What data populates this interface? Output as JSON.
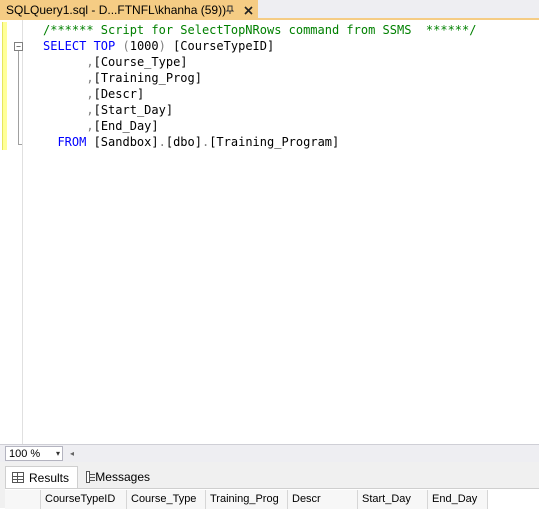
{
  "tab": {
    "title": "SQLQuery1.sql - D...FTNFL\\khanha (59))",
    "pin_icon": "pin-icon",
    "close_icon": "close-icon"
  },
  "editor": {
    "lines": [
      [
        {
          "t": "/****** Script for SelectTopNRows command from SSMS  ******/",
          "c": "cm"
        }
      ],
      [
        {
          "t": "SELECT ",
          "c": "kw"
        },
        {
          "t": "TOP ",
          "c": "kw"
        },
        {
          "t": "(",
          "c": "gr"
        },
        {
          "t": "1000",
          "c": ""
        },
        {
          "t": ") ",
          "c": "gr"
        },
        {
          "t": "[CourseTypeID]",
          "c": ""
        }
      ],
      [
        {
          "t": "      ",
          "c": ""
        },
        {
          "t": ",",
          "c": "gr"
        },
        {
          "t": "[Course_Type]",
          "c": ""
        }
      ],
      [
        {
          "t": "      ",
          "c": ""
        },
        {
          "t": ",",
          "c": "gr"
        },
        {
          "t": "[Training_Prog]",
          "c": ""
        }
      ],
      [
        {
          "t": "      ",
          "c": ""
        },
        {
          "t": ",",
          "c": "gr"
        },
        {
          "t": "[Descr]",
          "c": ""
        }
      ],
      [
        {
          "t": "      ",
          "c": ""
        },
        {
          "t": ",",
          "c": "gr"
        },
        {
          "t": "[Start_Day]",
          "c": ""
        }
      ],
      [
        {
          "t": "      ",
          "c": ""
        },
        {
          "t": ",",
          "c": "gr"
        },
        {
          "t": "[End_Day]",
          "c": ""
        }
      ],
      [
        {
          "t": "  FROM ",
          "c": "kw"
        },
        {
          "t": "[Sandbox]",
          "c": ""
        },
        {
          "t": ".",
          "c": "gr"
        },
        {
          "t": "[dbo]",
          "c": ""
        },
        {
          "t": ".",
          "c": "gr"
        },
        {
          "t": "[Training_Program]",
          "c": ""
        }
      ]
    ],
    "collapse_glyph": "−"
  },
  "zoom": {
    "value": "100 %",
    "arrow": "▾",
    "scroll_left": "◂"
  },
  "results": {
    "tabs": [
      {
        "label": "Results",
        "icon": "grid-icon"
      },
      {
        "label": "Messages",
        "icon": "messages-icon"
      }
    ],
    "columns": [
      {
        "label": "CourseTypeID",
        "w": 86
      },
      {
        "label": "Course_Type",
        "w": 79
      },
      {
        "label": "Training_Prog",
        "w": 82
      },
      {
        "label": "Descr",
        "w": 70
      },
      {
        "label": "Start_Day",
        "w": 70
      },
      {
        "label": "End_Day",
        "w": 60
      }
    ]
  }
}
